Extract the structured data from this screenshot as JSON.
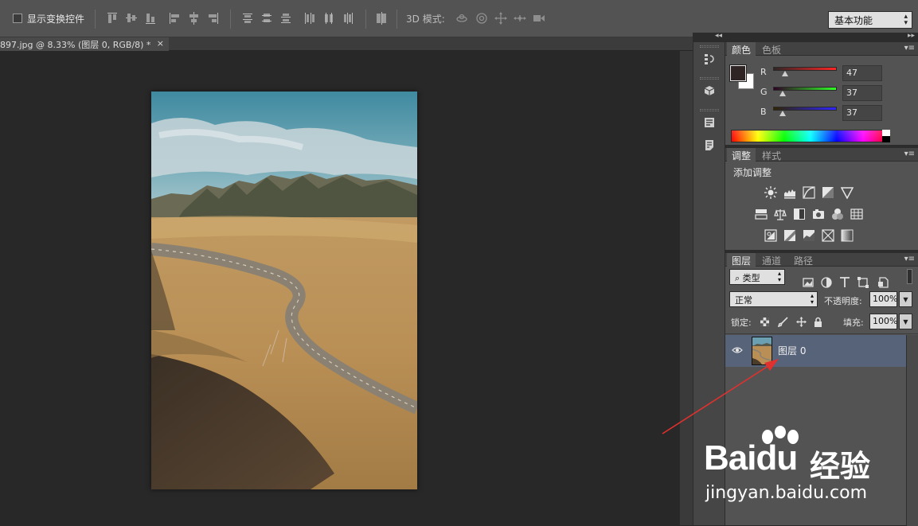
{
  "options_bar": {
    "show_transform_controls": "显示变换控件",
    "mode_3d_label": "3D 模式:",
    "workspace": "基本功能"
  },
  "document_tab": {
    "title": "897.jpg @ 8.33% (图层 0, RGB/8) *",
    "close": "×"
  },
  "panels": {
    "collapse_glyph": "◂◂",
    "expand_glyph": "▸▸",
    "menu_glyph": "▾≡",
    "color": {
      "tabs": [
        "颜色",
        "色板"
      ],
      "foreground_color": "#2f2525",
      "background_color": "#ffffff",
      "sliders": [
        {
          "label": "R",
          "value": "47",
          "fraction": 0.184
        },
        {
          "label": "G",
          "value": "37",
          "fraction": 0.145
        },
        {
          "label": "B",
          "value": "37",
          "fraction": 0.145
        }
      ]
    },
    "adjustments": {
      "tabs": [
        "调整",
        "样式"
      ],
      "title": "添加调整"
    },
    "layers": {
      "tabs": [
        "图层",
        "通道",
        "路径"
      ],
      "filter_kind": "类型",
      "blend_mode": "正常",
      "opacity_label": "不透明度:",
      "opacity_value": "100%",
      "lock_label": "锁定:",
      "fill_label": "填充:",
      "fill_value": "100%",
      "layer_name": "图层 0"
    }
  },
  "watermark": {
    "brand_bai": "Bai",
    "brand_du": "du",
    "brand_cn": "经验",
    "url": "jingyan.baidu.com"
  }
}
